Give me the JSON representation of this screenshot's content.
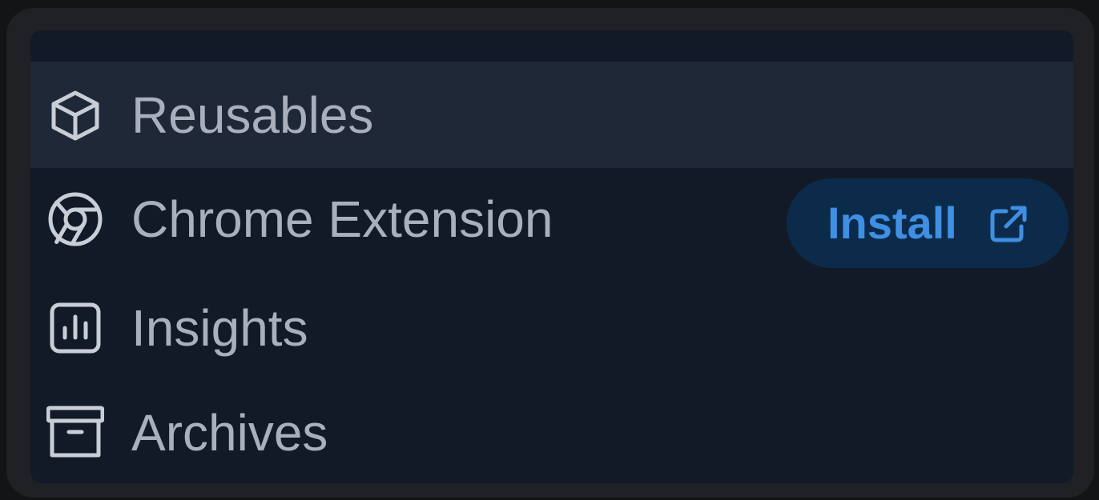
{
  "menu": {
    "items": [
      {
        "label": "Reusables",
        "icon": "cube-icon",
        "active": true
      },
      {
        "label": "Chrome Extension",
        "icon": "chrome-icon",
        "active": false
      },
      {
        "label": "Insights",
        "icon": "chart-icon",
        "active": false
      },
      {
        "label": "Archives",
        "icon": "archive-icon",
        "active": false
      }
    ],
    "install_label": "Install",
    "install_icon": "external-link-icon"
  },
  "colors": {
    "panel_bg": "#121a28",
    "active_row_bg": "#1f2837",
    "text": "#a9b0bc",
    "install_bg": "#0c2b4a",
    "install_text": "#3f8fe3"
  }
}
